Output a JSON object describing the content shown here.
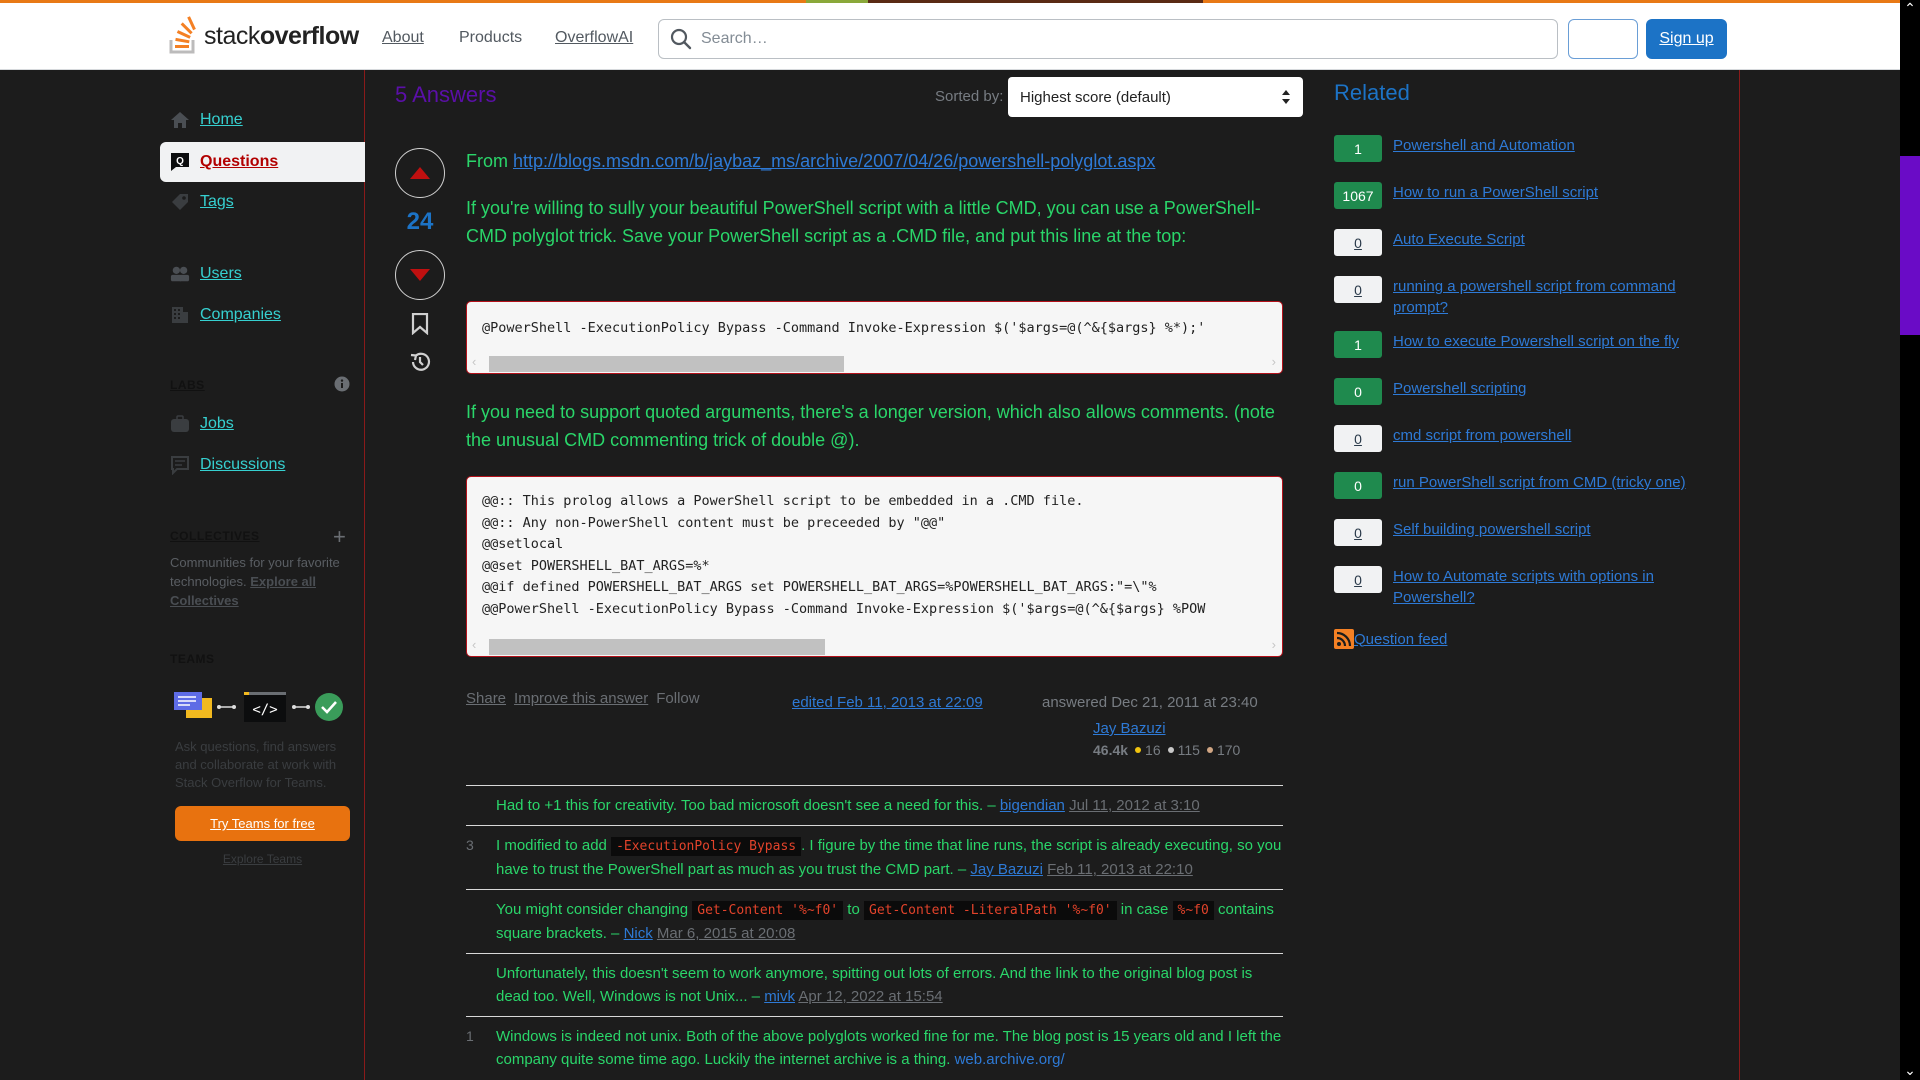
{
  "header": {
    "logo_light": "stack",
    "logo_bold": "overflow",
    "nav": [
      {
        "label": "About"
      },
      {
        "label": "Products"
      },
      {
        "label": "OverflowAI"
      }
    ],
    "search_placeholder": "Search…",
    "login_label": "",
    "signup_label": "Sign up",
    "colors": {
      "accent": "#e87916",
      "signup": "#1c73c6"
    }
  },
  "sidebar": {
    "items": [
      {
        "label": "Home",
        "icon": "home-icon"
      },
      {
        "label": "Questions",
        "icon": "questions-icon",
        "active": true
      },
      {
        "label": "Tags",
        "icon": "tag-icon"
      },
      {
        "label": "Users",
        "icon": "users-icon"
      },
      {
        "label": "Companies",
        "icon": "building-icon"
      },
      {
        "label": "Jobs",
        "icon": "briefcase-icon"
      },
      {
        "label": "Discussions",
        "icon": "discussion-icon"
      }
    ],
    "labs_heading": "LABS",
    "collectives_heading": "COLLECTIVES",
    "collectives_desc": "Communities for your favorite technologies. ",
    "collectives_link": "Explore all Collectives",
    "teams_heading": "TEAMS",
    "teams_desc": "Ask questions, find answers and collaborate at work with Stack Overflow for Teams.",
    "try_teams_label": "Try Teams for free",
    "explore_teams_label": "Explore Teams"
  },
  "answers": {
    "count_label": "5 Answers",
    "sorted_by_label": "Sorted by:",
    "sort_value": "Highest score (default)"
  },
  "post": {
    "score": "24",
    "from_label": "From ",
    "source_link": "http://blogs.msdn.com/b/jaybaz_ms/archive/2007/04/26/powershell-polyglot.aspx",
    "para1": "If you're willing to sully your beautiful PowerShell script with a little CMD, you can use a PowerShell-CMD polyglot trick. Save your PowerShell script as a .CMD file, and put this line at the top:",
    "code1": "@PowerShell -ExecutionPolicy Bypass -Command Invoke-Expression $('$args=@(^&{$args} %*);'",
    "para2": "If you need to support quoted arguments, there's a longer version, which also allows comments. (note the unusual CMD commenting trick of double @).",
    "code2": "@@:: This prolog allows a PowerShell script to be embedded in a .CMD file.\n@@:: Any non-PowerShell content must be preceeded by \"@@\"\n@@setlocal\n@@set POWERSHELL_BAT_ARGS=%*\n@@if defined POWERSHELL_BAT_ARGS set POWERSHELL_BAT_ARGS=%POWERSHELL_BAT_ARGS:\"=\\\"%\n@@PowerShell -ExecutionPolicy Bypass -Command Invoke-Expression $('$args=@(^&{$args} %POW",
    "menu": {
      "share": "Share",
      "improve": "Improve this answer",
      "follow": "Follow"
    },
    "edited": "edited Feb 11, 2013 at 22:09",
    "answered": "answered Dec 21, 2011 at 23:40",
    "user": {
      "name": "Jay Bazuzi",
      "reputation": "46.4k",
      "gold": "16",
      "silver": "115",
      "bronze": "170"
    }
  },
  "comments": [
    {
      "score": "",
      "parts": [
        {
          "t": "text",
          "v": "Had to +1 this for creativity. Too bad microsoft doesn't see a need for this. – "
        }
      ],
      "user": "bigendian",
      "date": "Jul 11, 2012 at 3:10"
    },
    {
      "score": "3",
      "parts": [
        {
          "t": "text",
          "v": "I modified to add "
        },
        {
          "t": "code",
          "v": "-ExecutionPolicy Bypass"
        },
        {
          "t": "text",
          "v": ". I figure by the time that line runs, the script is already executing, so you have to trust the PowerShell part as much as you trust the CMD part. – "
        }
      ],
      "user": "Jay Bazuzi",
      "date": "Feb 11, 2013 at 22:10"
    },
    {
      "score": "",
      "parts": [
        {
          "t": "text",
          "v": "You might consider changing "
        },
        {
          "t": "code",
          "v": "Get-Content '%~f0'"
        },
        {
          "t": "text",
          "v": " to "
        },
        {
          "t": "code",
          "v": "Get-Content -LiteralPath '%~f0'"
        },
        {
          "t": "text",
          "v": " in case "
        },
        {
          "t": "code",
          "v": "%~f0"
        },
        {
          "t": "text",
          "v": " contains square brackets. – "
        }
      ],
      "user": "Nick",
      "date": "Mar 6, 2015 at 20:08"
    },
    {
      "score": "",
      "parts": [
        {
          "t": "text",
          "v": "Unfortunately, this doesn't seem to work anymore, spitting out lots of errors. And the link to the original blog post is dead too. Well, Windows is not Unix... – "
        }
      ],
      "user": "mivk",
      "date": "Apr 12, 2022 at 15:54"
    },
    {
      "score": "1",
      "parts": [
        {
          "t": "text",
          "v": "Windows is indeed not unix. Both of the above polyglots worked fine for me. The blog post is 15 years old and I left the company quite some time ago. Luckily the internet archive is a thing. "
        },
        {
          "t": "link",
          "v": "web.archive.org/"
        }
      ],
      "user": "",
      "date": ""
    }
  ],
  "related": {
    "title": "Related",
    "items": [
      {
        "score": "1",
        "answered": true,
        "title": "Powershell and Automation"
      },
      {
        "score": "1067",
        "answered": true,
        "title": "How to run a PowerShell script"
      },
      {
        "score": "0",
        "answered": false,
        "title": "Auto Execute Script"
      },
      {
        "score": "0",
        "answered": false,
        "title": "running a powershell script from command prompt?"
      },
      {
        "score": "1",
        "answered": true,
        "title": "How to execute Powershell script on the fly"
      },
      {
        "score": "0",
        "answered": true,
        "title": "Powershell scripting"
      },
      {
        "score": "0",
        "answered": false,
        "title": "cmd script from powershell"
      },
      {
        "score": "0",
        "answered": true,
        "title": "run PowerShell script from CMD (tricky one)"
      },
      {
        "score": "0",
        "answered": false,
        "title": "Self building powershell script"
      },
      {
        "score": "0",
        "answered": false,
        "title": "How to Automate scripts with options in Powershell?"
      }
    ],
    "feed_label": " Question feed"
  }
}
